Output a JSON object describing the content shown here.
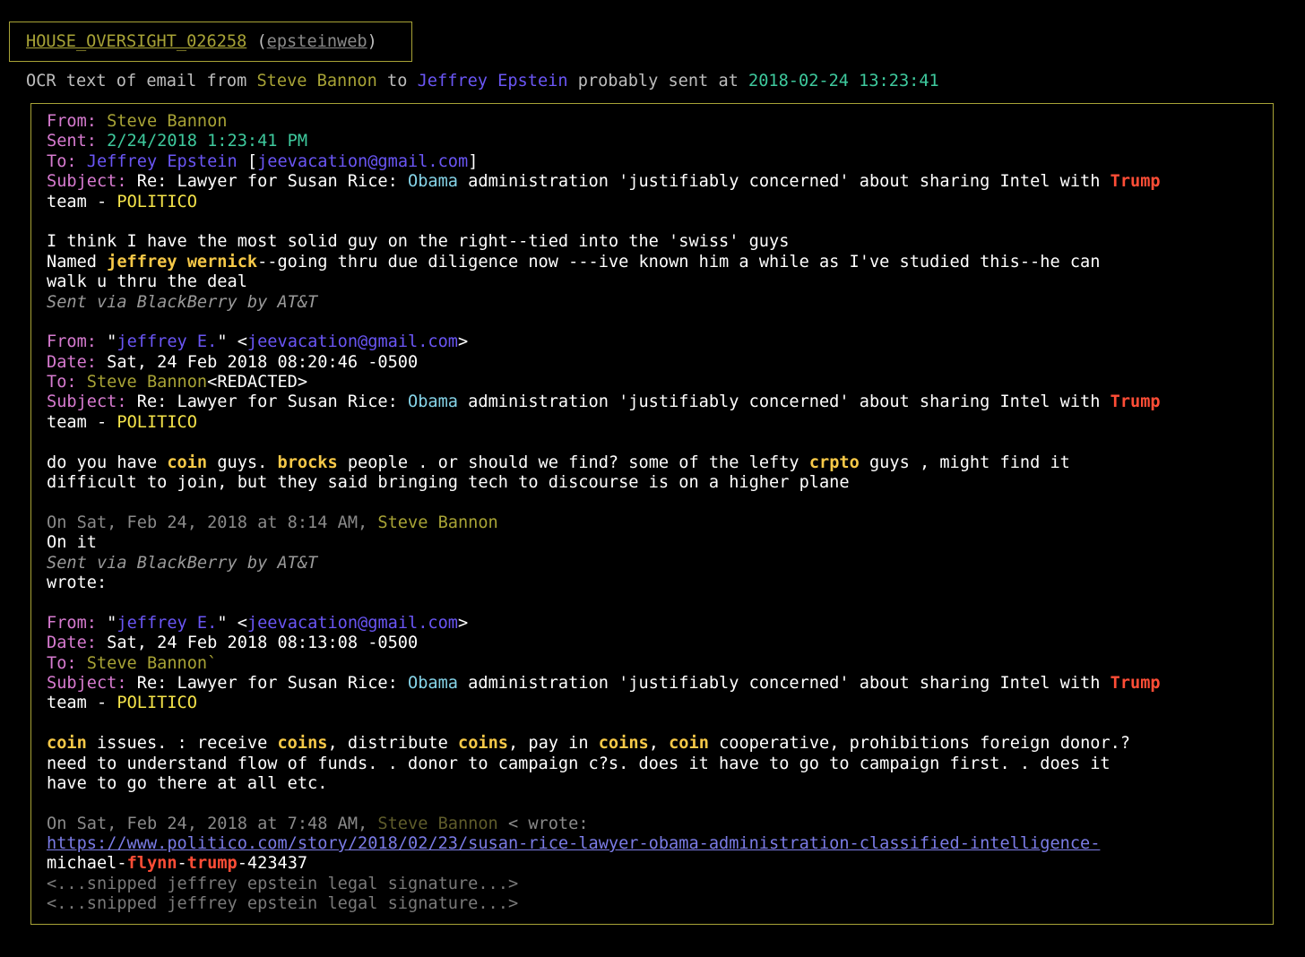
{
  "header": {
    "doc_id": "HOUSE_OVERSIGHT_026258",
    "open_paren": " (",
    "source": "epsteinweb",
    "close_paren": ")"
  },
  "summary": {
    "prefix": "OCR text of email from ",
    "from_name": "Steve Bannon",
    "to_word": " to ",
    "to_name": "Jeffrey Epstein",
    "sent_word": " probably sent at ",
    "sent_at": "2018-02-24 13:23:41"
  },
  "msg1": {
    "from_label": "From: ",
    "from_name": "Steve Bannon",
    "sent_label": "Sent: ",
    "sent_value": "2/24/2018 1:23:41 PM",
    "to_label": "To: ",
    "to_name": "Jeffrey Epstein",
    "to_open": " [",
    "to_email": "jeevacation@gmail.com",
    "to_close": "]",
    "subject_label": "Subject: ",
    "subject_a": "Re: Lawyer for Susan Rice: ",
    "subject_obama": "Obama",
    "subject_b": " administration 'justifiably concerned' about sharing Intel with ",
    "subject_trump": "Trump",
    "subject_team": "team - ",
    "subject_politico": "POLITICO",
    "body1": "I think I have the most solid guy on the right--tied into the 'swiss' guys",
    "body2_a": "Named ",
    "body2_hl": "jeffrey wernick",
    "body2_b": "--going thru due diligence now ---ive known him a while as I've studied this--he can",
    "body3": "walk u thru the deal",
    "signature": "Sent via BlackBerry by AT&T"
  },
  "msg2": {
    "from_label": "From: ",
    "from_q1": "\"",
    "from_name": "jeffrey E.",
    "from_q2": "\" <",
    "from_email": "jeevacation@gmail.com",
    "from_close": ">",
    "date_label": "Date: ",
    "date_value": "Sat, 24 Feb 2018 08:20:46 -0500",
    "to_label": "To: ",
    "to_name": "Steve Bannon",
    "to_rest": "<REDACTED>",
    "subject_label": "Subject: ",
    "subject_a": "Re: Lawyer for Susan Rice: ",
    "subject_obama": "Obama",
    "subject_b": " administration 'justifiably concerned' about sharing Intel with ",
    "subject_trump": "Trump",
    "subject_team": "team - ",
    "subject_politico": "POLITICO",
    "body1_a": "do you have ",
    "body1_coin": "coin",
    "body1_b": " guys. ",
    "body1_brocks": "brocks",
    "body1_c": " people . or should we find? some of the lefty ",
    "body1_crpto": "crpto",
    "body1_d": " guys , might find it",
    "body2": "difficult to join, but they said bringing tech to discourse is on a higher plane"
  },
  "quote1": {
    "on_text": "On Sat, Feb 24, 2018 at 8:14 AM, ",
    "name": "Steve Bannon",
    "body": "On it",
    "signature": "Sent via BlackBerry by AT&T",
    "wrote": "wrote:"
  },
  "msg3": {
    "from_label": "From: ",
    "from_q1": "\"",
    "from_name": "jeffrey E.",
    "from_q2": "\" <",
    "from_email": "jeevacation@gmail.com",
    "from_close": ">",
    "date_label": "Date: ",
    "date_value": "Sat, 24 Feb 2018 08:13:08 -0500",
    "to_label": "To: ",
    "to_name": "Steve Bannon",
    "to_rest": "`",
    "subject_label": "Subject: ",
    "subject_a": "Re: Lawyer for Susan Rice: ",
    "subject_obama": "Obama",
    "subject_b": " administration 'justifiably concerned' about sharing Intel with ",
    "subject_trump": "Trump",
    "subject_team": "team - ",
    "subject_politico": "POLITICO",
    "body1_coin1": "coin",
    "body1_a": " issues. : receive ",
    "body1_coins1": "coins",
    "body1_b": ", distribute ",
    "body1_coins2": "coins",
    "body1_c": ", pay in ",
    "body1_coins3": "coins",
    "body1_d": ", ",
    "body1_coin2": "coin",
    "body1_e": " cooperative, prohibitions foreign donor.?",
    "body2": "need to understand flow of funds. . donor to campaign c?s. does it have to go to campaign first. . does it",
    "body3": "have to go there at all etc."
  },
  "quote2": {
    "on_text": "On Sat, Feb 24, 2018 at 7:48 AM, ",
    "name": "Steve Bannon",
    "wrote": " < wrote:",
    "url": "https://www.politico.com/story/2018/02/23/susan-rice-lawyer-obama-administration-classified-intelligence-",
    "url2_a": "michael-",
    "url2_flynn": "flynn",
    "url2_b": "-",
    "url2_trump": "trump",
    "url2_c": "-423437",
    "snip1": "<...snipped jeffrey epstein legal signature...>",
    "snip2": "<...snipped jeffrey epstein legal signature...>"
  },
  "colors": {
    "background": "#000000",
    "border": "#a8a336",
    "header_label": "#d77bd0",
    "name_olive": "#a8a336",
    "name_blue": "#6a56f5",
    "date_green": "#3ec99d",
    "obama": "#86d4e8",
    "trump": "#ff4d36",
    "politico": "#f5e44a",
    "highlight": "#f7c948"
  }
}
